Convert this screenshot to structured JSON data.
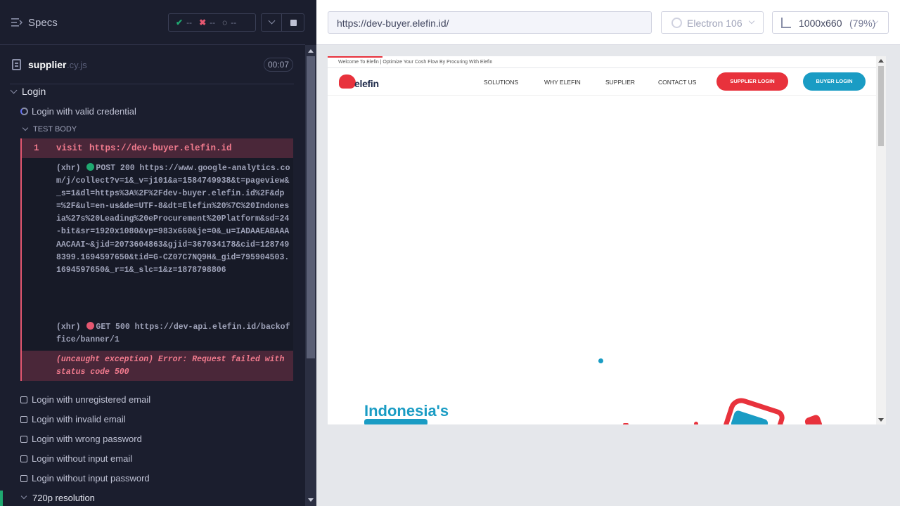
{
  "colors": {
    "runner_bg": "#1b1e2e",
    "pass": "#1fa971",
    "fail": "#e45770",
    "brand_red": "#e8323c",
    "brand_blue": "#1a9cc4"
  },
  "sidebar": {
    "title": "Specs",
    "stats": {
      "passed": "--",
      "failed": "--",
      "pending": "--"
    },
    "file": {
      "name": "supplier",
      "ext": ".cy.js",
      "duration": "00:07"
    },
    "suite": "Login",
    "active_test": "Login with valid credential",
    "test_body_label": "TEST BODY",
    "command": {
      "num": "1",
      "name": "visit",
      "message": "https://dev-buyer.elefin.id"
    },
    "xhr1": {
      "prefix": "(xhr)",
      "text": "POST 200 https://www.google-analytics.com/j/collect?v=1&_v=j101&a=1584749938&t=pageview&_s=1&dl=https%3A%2F%2Fdev-buyer.elefin.id%2F&dp=%2F&ul=en-us&de=UTF-8&dt=Elefin%20%7C%20Indonesia%27s%20Leading%20eProcurement%20Platform&sd=24-bit&sr=1920x1080&vp=983x660&je=0&_u=IADAAEABAAAAACAAI~&jid=2073604863&gjid=367034178&cid=1287498399.1694597650&tid=G-CZ07C7NQ9H&_gid=795904503.1694597650&_r=1&_slc=1&z=1878798806"
    },
    "xhr2": {
      "prefix": "(xhr)",
      "text": "GET 500 https://dev-api.elefin.id/backoffice/banner/1"
    },
    "error": "(uncaught exception)  Error: Request failed with status code 500",
    "tests": [
      "Login with unregistered email",
      "Login with invalid email",
      "Login with wrong password",
      "Login without input email",
      "Login without input password"
    ],
    "next_suite": "720p resolution"
  },
  "topbar": {
    "url": "https://dev-buyer.elefin.id/",
    "browser": "Electron 106",
    "viewport": "1000x660",
    "zoom": "(79%)"
  },
  "site": {
    "welcome": "Welcome To Elefin | Optimize Your Cosh Flow By Procuring With Elefin",
    "logo": "elefin",
    "nav": [
      "SOLUTIONS",
      "WHY ELEFIN",
      "SUPPLIER",
      "CONTACT US"
    ],
    "supplier_login": "SUPPLIER LOGIN",
    "buyer_login": "BUYER LOGIN",
    "hero": "Indonesia's"
  }
}
